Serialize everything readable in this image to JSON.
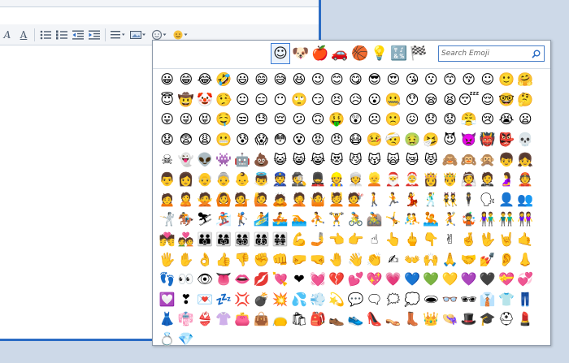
{
  "toolbar": {
    "italic_a": "A",
    "underline_a": "A"
  },
  "picker": {
    "categories": [
      {
        "name": "smileys",
        "glyph": "☺"
      },
      {
        "name": "animals",
        "glyph": "🐶"
      },
      {
        "name": "food",
        "glyph": "🍎"
      },
      {
        "name": "travel",
        "glyph": "🚗"
      },
      {
        "name": "activity",
        "glyph": "🏀"
      },
      {
        "name": "objects",
        "glyph": "💡"
      },
      {
        "name": "symbols",
        "glyph": "🔣"
      },
      {
        "name": "flags",
        "glyph": "🏁"
      }
    ],
    "selected_category": "smileys",
    "search_placeholder": "Search Emoji",
    "search_value": "",
    "emojis": [
      "😀",
      "😁",
      "😂",
      "🤣",
      "😃",
      "😄",
      "😅",
      "😆",
      "😉",
      "😊",
      "😋",
      "😎",
      "😍",
      "😘",
      "😗",
      "😙",
      "😚",
      "☺",
      "🙂",
      "🤗",
      "😇",
      "🤠",
      "🤡",
      "🤥",
      "😐",
      "😑",
      "😶",
      "🙄",
      "😏",
      "😣",
      "😥",
      "😮",
      "🤐",
      "😯",
      "😪",
      "😫",
      "😴",
      "😌",
      "🤓",
      "🤔",
      "😛",
      "😜",
      "😝",
      "🤤",
      "😒",
      "😓",
      "😔",
      "😕",
      "🙃",
      "🤑",
      "😲",
      "☹",
      "🙁",
      "😖",
      "😞",
      "😟",
      "😤",
      "😢",
      "😭",
      "😦",
      "😧",
      "😨",
      "😩",
      "😬",
      "😰",
      "😱",
      "😳",
      "😵",
      "😡",
      "😠",
      "😷",
      "🤒",
      "🤕",
      "🤢",
      "🤧",
      "😈",
      "👿",
      "👹",
      "👺",
      "💀",
      "☠",
      "👻",
      "👽",
      "👾",
      "🤖",
      "💩",
      "😺",
      "😸",
      "😹",
      "😻",
      "😼",
      "😽",
      "🙀",
      "😿",
      "😾",
      "🙈",
      "🙉",
      "🙊",
      "👦",
      "👧",
      "👨",
      "👩",
      "👴",
      "👵",
      "👶",
      "👼",
      "👮",
      "🕵",
      "💂",
      "👷",
      "👳",
      "👱",
      "🎅",
      "🤶",
      "👸",
      "🤴",
      "👰",
      "🤵",
      "🤰",
      "👲",
      "🙍",
      "🙎",
      "🙅",
      "🙆",
      "💁",
      "🙋",
      "🙇",
      "🤦",
      "🤷",
      "💆",
      "💇",
      "🚶",
      "🏃",
      "💃",
      "🕺",
      "👯",
      "🕴",
      "🗣",
      "👤",
      "👥",
      "🤺",
      "🏇",
      "⛷",
      "🏂",
      "🏌",
      "🏄",
      "🚣",
      "🏊",
      "⛹",
      "🏋",
      "🚴",
      "🚵",
      "🤸",
      "🤼",
      "🤽",
      "🤾",
      "🤹",
      "👫",
      "👬",
      "👭",
      "💏",
      "💑",
      "👪",
      "👨‍👩‍👧",
      "👨‍👩‍👧‍👦",
      "👨‍👩‍👦‍👦",
      "👨‍👩‍👧‍👧",
      "💪",
      "🤳",
      "👈",
      "👉",
      "☝",
      "👆",
      "🖕",
      "👇",
      "✌",
      "🤞",
      "🖖",
      "🤘",
      "🤙",
      "🖐",
      "✋",
      "👌",
      "👍",
      "👎",
      "✊",
      "👊",
      "🤛",
      "🤜",
      "🤚",
      "👋",
      "👏",
      "✍",
      "👐",
      "🙌",
      "🙏",
      "🤝",
      "💅",
      "👂",
      "👃",
      "👣",
      "👀",
      "👁",
      "👅",
      "👄",
      "💋",
      "💘",
      "❤",
      "💓",
      "💔",
      "💕",
      "💖",
      "💗",
      "💙",
      "💚",
      "💛",
      "💜",
      "🖤",
      "💝",
      "💞",
      "💟",
      "❣",
      "💌",
      "💤",
      "💢",
      "💣",
      "💥",
      "💦",
      "💨",
      "💫",
      "💬",
      "🗨",
      "🗯",
      "💭",
      "🕳",
      "👓",
      "🕶",
      "👔",
      "👕",
      "👖",
      "👗",
      "👘",
      "👙",
      "👚",
      "👛",
      "👜",
      "👝",
      "🛍",
      "🎒",
      "👞",
      "👟",
      "👠",
      "👡",
      "👢",
      "👑",
      "👒",
      "🎩",
      "🎓",
      "⛑",
      "💄",
      "💍",
      "💎"
    ]
  }
}
